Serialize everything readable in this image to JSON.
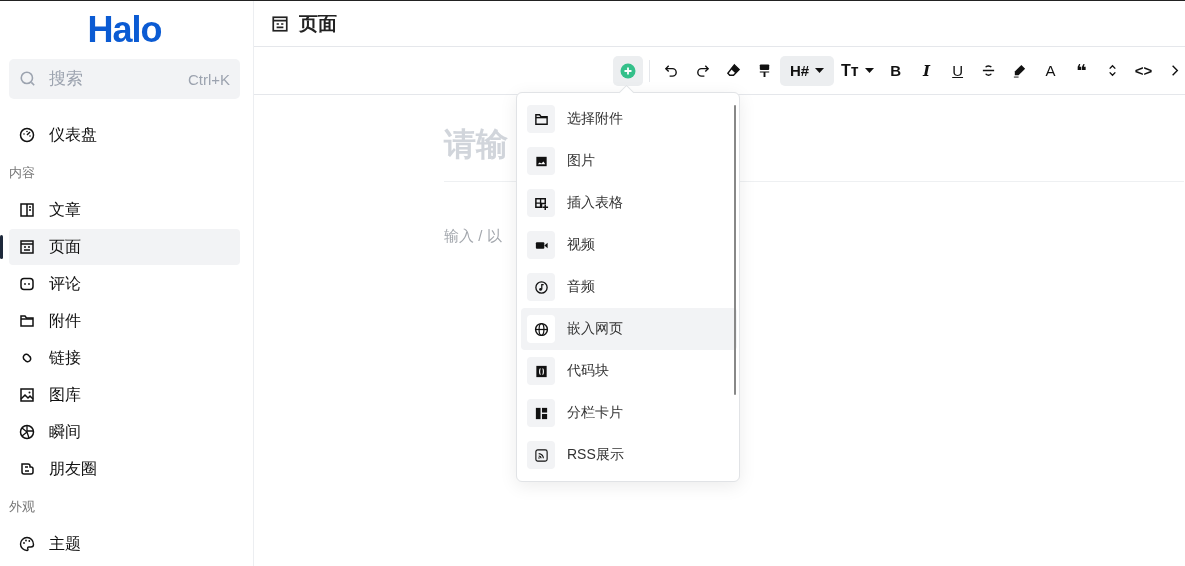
{
  "sidebar": {
    "logo": "Halo",
    "search": {
      "placeholder": "搜索",
      "shortcut": "Ctrl+K"
    },
    "groups": [
      {
        "items": [
          {
            "label": "仪表盘",
            "selected": false
          }
        ]
      },
      {
        "title": "内容",
        "items": [
          {
            "label": "文章",
            "selected": false
          },
          {
            "label": "页面",
            "selected": true
          },
          {
            "label": "评论",
            "selected": false
          },
          {
            "label": "附件",
            "selected": false
          },
          {
            "label": "链接",
            "selected": false
          },
          {
            "label": "图库",
            "selected": false
          },
          {
            "label": "瞬间",
            "selected": false
          },
          {
            "label": "朋友圈",
            "selected": false
          }
        ]
      },
      {
        "title": "外观",
        "items": [
          {
            "label": "主题",
            "selected": false
          }
        ]
      }
    ]
  },
  "header": {
    "title": "页面"
  },
  "toolbar": [
    {
      "kind": "insert",
      "selected": true
    },
    {
      "kind": "undo"
    },
    {
      "kind": "redo"
    },
    {
      "kind": "eraser"
    },
    {
      "kind": "painter"
    },
    {
      "kind": "heading",
      "label": "H#",
      "selected": true
    },
    {
      "kind": "size",
      "label": "Tт"
    },
    {
      "kind": "bold",
      "label": "B"
    },
    {
      "kind": "italic",
      "label": "I"
    },
    {
      "kind": "underline",
      "label": "U"
    },
    {
      "kind": "strike"
    },
    {
      "kind": "highlight"
    },
    {
      "kind": "color",
      "label": "A"
    },
    {
      "kind": "quote",
      "label": "❝"
    },
    {
      "kind": "updown"
    },
    {
      "kind": "code",
      "label": "<>"
    },
    {
      "kind": "more"
    }
  ],
  "editor": {
    "title_placeholder": "请输",
    "body_placeholder": "输入 / 以"
  },
  "insert_menu": [
    {
      "label": "选择附件",
      "selected": false
    },
    {
      "label": "图片",
      "selected": false
    },
    {
      "label": "插入表格",
      "selected": false
    },
    {
      "label": "视频",
      "selected": false
    },
    {
      "label": "音频",
      "selected": false
    },
    {
      "label": "嵌入网页",
      "selected": true
    },
    {
      "label": "代码块",
      "selected": false
    },
    {
      "label": "分栏卡片",
      "selected": false
    },
    {
      "label": "RSS展示",
      "selected": false
    }
  ]
}
